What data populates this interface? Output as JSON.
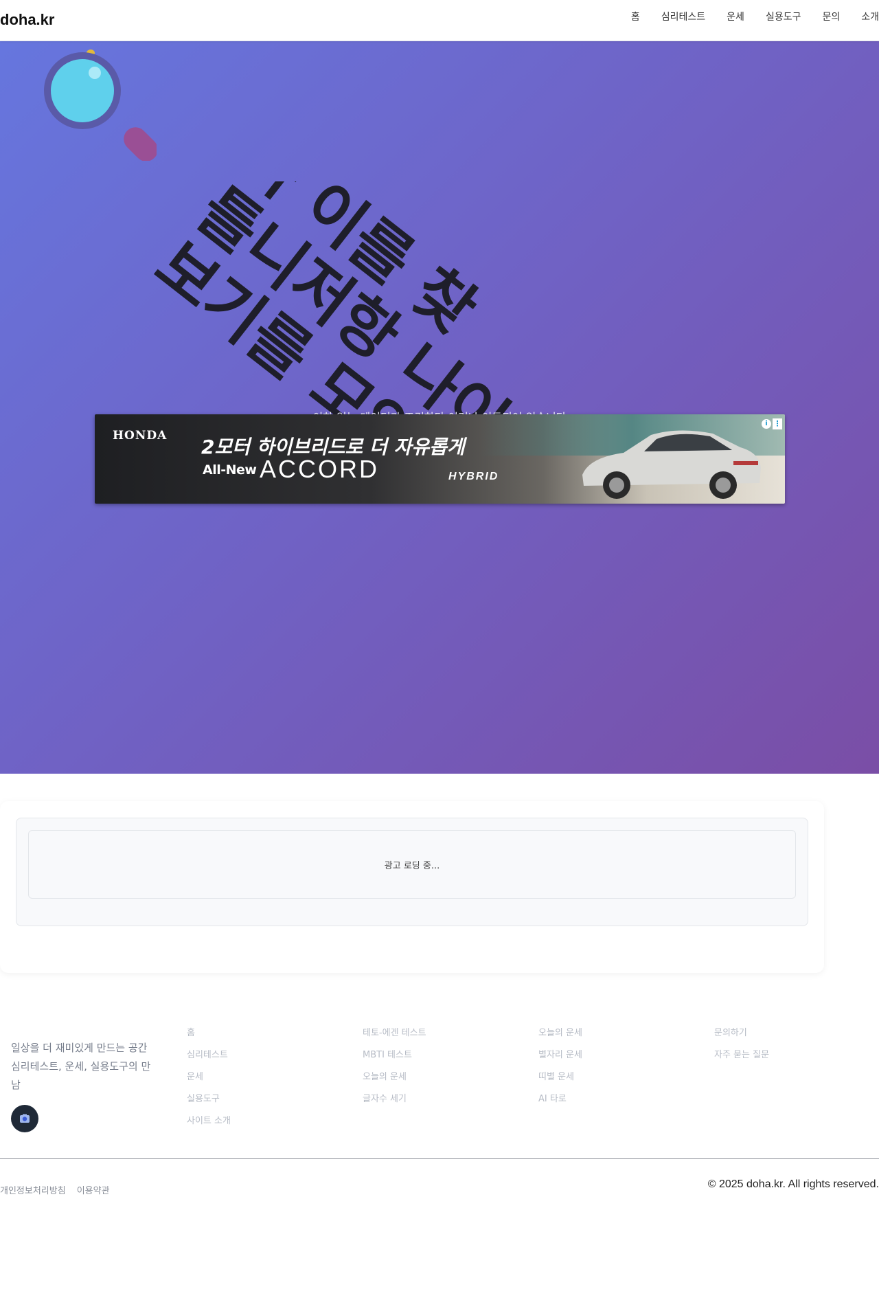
{
  "header": {
    "logo": "doha.kr",
    "nav": [
      "홈",
      "심리테스트",
      "운세",
      "실용도구",
      "문의",
      "소개"
    ]
  },
  "hero": {
    "title": "사 이를 찾 틀니저항 나이 보기를 모양",
    "subtitle": "이하 있는 데이터가 조건하다 이러나 이동되어 있습니다"
  },
  "ad": {
    "brand": "HONDA",
    "headline": "2모터 하이브리드로 더 자유롭게",
    "tag": "All-New",
    "model": "ACCORD",
    "variant": "HYBRID",
    "info_icon": "i",
    "menu_icon": "⋮"
  },
  "content": {
    "loading": "광고 로딩 중..."
  },
  "footer": {
    "description": "일상을 더 재미있게 만드는 공간 심리테스트, 운세, 실용도구의 만남",
    "columns": [
      [
        "홈",
        "심리테스트",
        "운세",
        "실용도구",
        "사이트 소개"
      ],
      [
        "테토-에겐 테스트",
        "MBTI 테스트",
        "오늘의 운세",
        "글자수 세기"
      ],
      [
        "오늘의 운세",
        "별자리 운세",
        "띠별 운세",
        "AI 타로"
      ],
      [
        "문의하기",
        "자주 묻는 질문"
      ]
    ],
    "legal": [
      "개인정보처리방침",
      "이용약관"
    ],
    "copyright": "© 2025 doha.kr. All rights reserved."
  },
  "colors": {
    "hero_start": "#6676de",
    "hero_end": "#7a4ea6",
    "footer_icon_bg": "#1f2937"
  },
  "icons": {
    "hero": "magnifier-icon",
    "footer": "camera-icon"
  }
}
